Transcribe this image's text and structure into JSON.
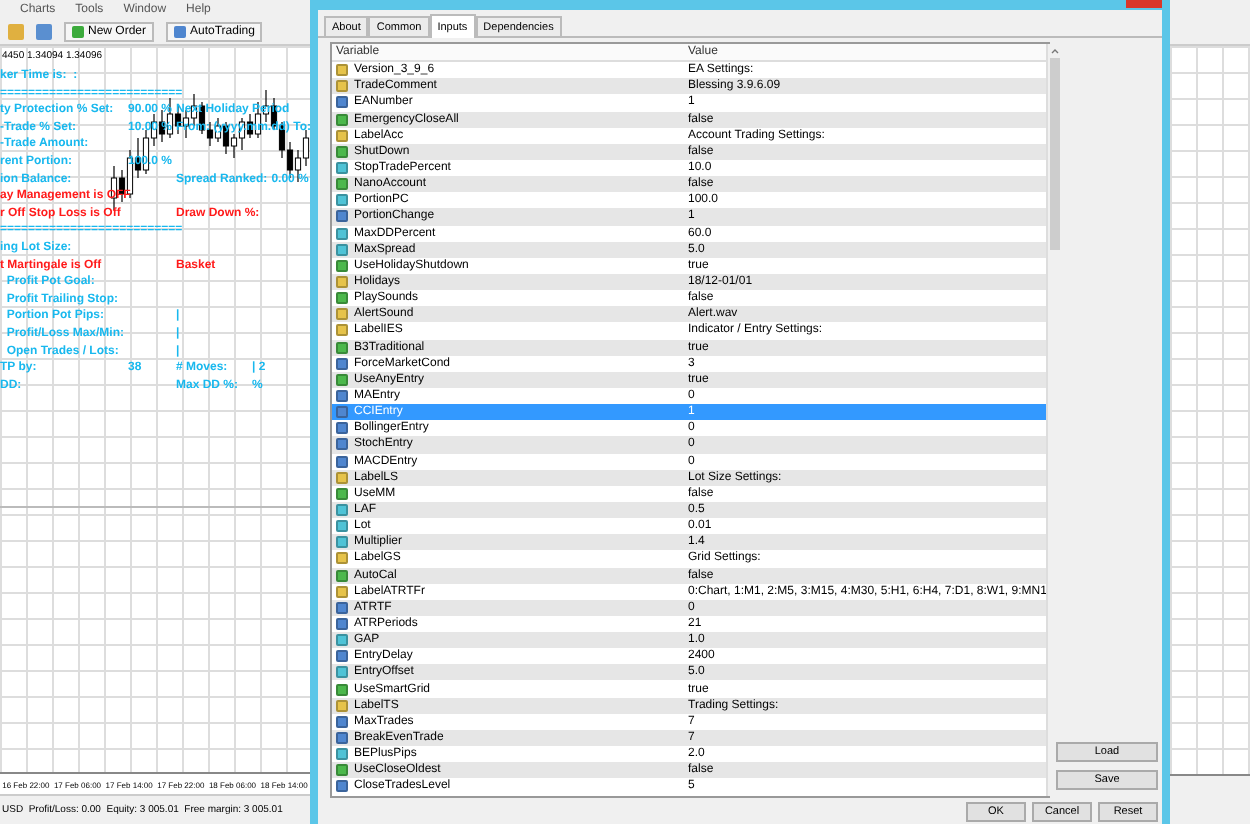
{
  "menu": [
    "Charts",
    "Tools",
    "Window",
    "Help"
  ],
  "toolbar": {
    "buttons": [
      "New Order",
      "AutoTrading"
    ]
  },
  "chart": {
    "quote": "4450 1.34094 1.34096",
    "info_lines": [
      {
        "alert": false,
        "label": "ker Time is:  :"
      },
      {
        "alert": false,
        "label": "=========================="
      },
      {
        "alert": false,
        "label": "ty Protection % Set:",
        "value": "90.00 %",
        "label_2": "Next Holiday Period"
      },
      {
        "alert": false,
        "label": "-Trade % Set:",
        "value": "10.00 %",
        "label_2": "From: (yyyy.mm.dd) To:"
      },
      {
        "alert": false,
        "label": "-Trade Amount:"
      },
      {
        "alert": false,
        "label": "rent Portion:",
        "value": "100.0 %"
      },
      {
        "alert": false,
        "label": "ion Balance:",
        "label_2": "Spread Ranked:",
        "value_2": "0.00 %"
      },
      {
        "alert": true,
        "label": "ay Management is OFF"
      },
      {
        "alert": true,
        "label": "r Off Stop Loss is Off",
        "label_2": "Draw Down %:"
      },
      {
        "alert": false,
        "label": "=========================="
      },
      {
        "alert": false,
        "label": "ing Lot Size:"
      },
      {
        "alert": true,
        "label": "t Martingale is Off",
        "label_2": "Basket"
      },
      {
        "alert": false,
        "label": "  Profit Pot Goal:"
      },
      {
        "alert": false,
        "label": "  Profit Trailing Stop:"
      },
      {
        "alert": false,
        "label": "  Portion Pot Pips:",
        "label_2": "|"
      },
      {
        "alert": false,
        "label": "  Profit/Loss Max/Min:",
        "label_2": "|"
      },
      {
        "alert": false,
        "label": "  Open Trades / Lots:",
        "label_2": "|"
      },
      {
        "alert": false,
        "label": "TP by:",
        "value": "38",
        "label_2": "# Moves:",
        "value_2": "| 2"
      },
      {
        "alert": false,
        "label": "DD:",
        "label_2": "Max DD %:",
        "value_2": "%"
      }
    ],
    "time_labels": [
      "16 Feb 22:00",
      "17 Feb 06:00",
      "17 Feb 14:00",
      "17 Feb 22:00",
      "18 Feb 06:00",
      "18 Feb 14:00"
    ]
  },
  "status_bar": "USD  Profit/Loss: 0.00  Equity: 3 005.01  Free margin: 3 005.01",
  "dialog": {
    "tabs": [
      {
        "label": "About",
        "selected": false
      },
      {
        "label": "Common",
        "selected": false
      },
      {
        "label": "Inputs",
        "selected": true
      },
      {
        "label": "Dependencies",
        "selected": false
      }
    ],
    "columns": [
      "Variable",
      "Value"
    ],
    "rows": [
      {
        "kind": "string",
        "name": "Version_3_9_6",
        "value": "EA Settings:",
        "selected": false
      },
      {
        "kind": "string",
        "name": "TradeComment",
        "value": "Blessing 3.9.6.09",
        "selected": false
      },
      {
        "kind": "int",
        "name": "EANumber",
        "value": "1",
        "selected": false
      },
      {
        "kind": "bool",
        "name": "EmergencyCloseAll",
        "value": "false",
        "selected": false
      },
      {
        "kind": "string",
        "name": "LabelAcc",
        "value": "Account Trading Settings:",
        "selected": false
      },
      {
        "kind": "bool",
        "name": "ShutDown",
        "value": "false",
        "selected": false
      },
      {
        "kind": "double",
        "name": "StopTradePercent",
        "value": "10.0",
        "selected": false
      },
      {
        "kind": "bool",
        "name": "NanoAccount",
        "value": "false",
        "selected": false
      },
      {
        "kind": "double",
        "name": "PortionPC",
        "value": "100.0",
        "selected": false
      },
      {
        "kind": "int",
        "name": "PortionChange",
        "value": "1",
        "selected": false
      },
      {
        "kind": "double",
        "name": "MaxDDPercent",
        "value": "60.0",
        "selected": false
      },
      {
        "kind": "double",
        "name": "MaxSpread",
        "value": "5.0",
        "selected": false
      },
      {
        "kind": "bool",
        "name": "UseHolidayShutdown",
        "value": "true",
        "selected": false
      },
      {
        "kind": "string",
        "name": "Holidays",
        "value": "18/12-01/01",
        "selected": false
      },
      {
        "kind": "bool",
        "name": "PlaySounds",
        "value": "false",
        "selected": false
      },
      {
        "kind": "string",
        "name": "AlertSound",
        "value": "Alert.wav",
        "selected": false
      },
      {
        "kind": "string",
        "name": "LabelIES",
        "value": "Indicator / Entry Settings:",
        "selected": false
      },
      {
        "kind": "bool",
        "name": "B3Traditional",
        "value": "true",
        "selected": false
      },
      {
        "kind": "int",
        "name": "ForceMarketCond",
        "value": "3",
        "selected": false
      },
      {
        "kind": "bool",
        "name": "UseAnyEntry",
        "value": "true",
        "selected": false
      },
      {
        "kind": "int",
        "name": "MAEntry",
        "value": "0",
        "selected": false
      },
      {
        "kind": "int",
        "name": "CCIEntry",
        "value": "1",
        "selected": true
      },
      {
        "kind": "int",
        "name": "BollingerEntry",
        "value": "0",
        "selected": false
      },
      {
        "kind": "int",
        "name": "StochEntry",
        "value": "0",
        "selected": false
      },
      {
        "kind": "int",
        "name": "MACDEntry",
        "value": "0",
        "selected": false
      },
      {
        "kind": "string",
        "name": "LabelLS",
        "value": "Lot Size Settings:",
        "selected": false
      },
      {
        "kind": "bool",
        "name": "UseMM",
        "value": "false",
        "selected": false
      },
      {
        "kind": "double",
        "name": "LAF",
        "value": "0.5",
        "selected": false
      },
      {
        "kind": "double",
        "name": "Lot",
        "value": "0.01",
        "selected": false
      },
      {
        "kind": "double",
        "name": "Multiplier",
        "value": "1.4",
        "selected": false
      },
      {
        "kind": "string",
        "name": "LabelGS",
        "value": "Grid Settings:",
        "selected": false
      },
      {
        "kind": "bool",
        "name": "AutoCal",
        "value": "false",
        "selected": false
      },
      {
        "kind": "string",
        "name": "LabelATRTFr",
        "value": "0:Chart, 1:M1, 2:M5, 3:M15, 4:M30, 5:H1, 6:H4, 7:D1, 8:W1, 9:MN1",
        "selected": false
      },
      {
        "kind": "int",
        "name": "ATRTF",
        "value": "0",
        "selected": false
      },
      {
        "kind": "int",
        "name": "ATRPeriods",
        "value": "21",
        "selected": false
      },
      {
        "kind": "double",
        "name": "GAP",
        "value": "1.0",
        "selected": false
      },
      {
        "kind": "int",
        "name": "EntryDelay",
        "value": "2400",
        "selected": false
      },
      {
        "kind": "double",
        "name": "EntryOffset",
        "value": "5.0",
        "selected": false
      },
      {
        "kind": "bool",
        "name": "UseSmartGrid",
        "value": "true",
        "selected": false
      },
      {
        "kind": "string",
        "name": "LabelTS",
        "value": "Trading Settings:",
        "selected": false
      },
      {
        "kind": "int",
        "name": "MaxTrades",
        "value": "7",
        "selected": false
      },
      {
        "kind": "int",
        "name": "BreakEvenTrade",
        "value": "7",
        "selected": false
      },
      {
        "kind": "double",
        "name": "BEPlusPips",
        "value": "2.0",
        "selected": false
      },
      {
        "kind": "bool",
        "name": "UseCloseOldest",
        "value": "false",
        "selected": false
      },
      {
        "kind": "int",
        "name": "CloseTradesLevel",
        "value": "5",
        "selected": false
      }
    ],
    "side_buttons": [
      "Load",
      "Save"
    ],
    "buttons": [
      "OK",
      "Cancel",
      "Reset"
    ]
  }
}
